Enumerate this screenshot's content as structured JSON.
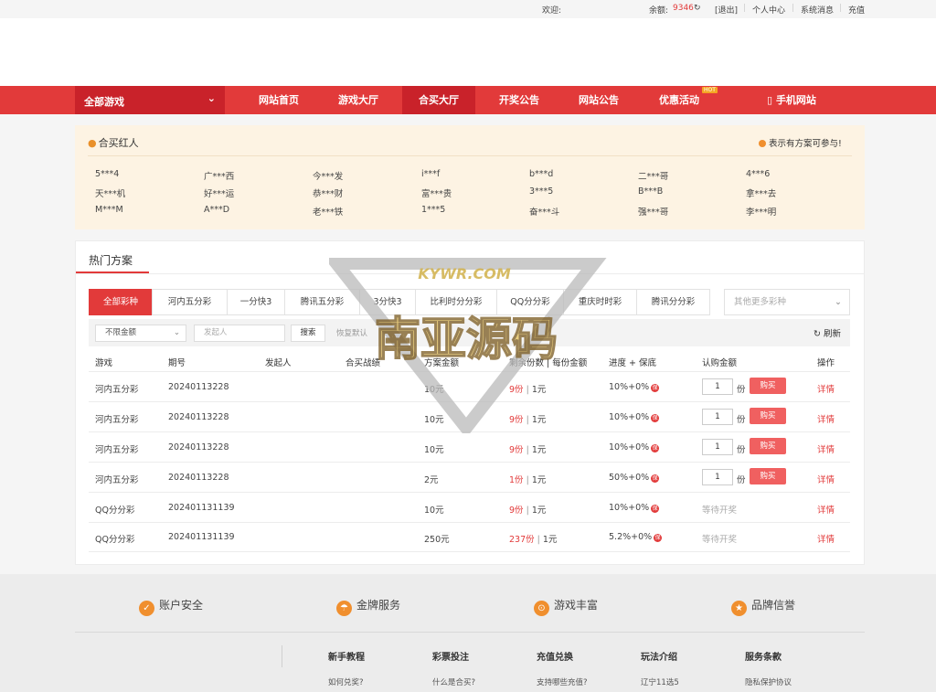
{
  "topbar": {
    "welcome": "欢迎:",
    "balance_label": "余额:",
    "balance_value": "9346",
    "refresh_icon": "↻",
    "logout": "[退出]",
    "user_center": "个人中心",
    "messages": "系统消息",
    "recharge": "充值"
  },
  "nav": {
    "all_games": "全部游戏",
    "items": [
      "网站首页",
      "游戏大厅",
      "合买大厅",
      "开奖公告",
      "网站公告",
      "优惠活动",
      "手机网站"
    ],
    "hot_badge": "HOT",
    "accent": "#e23a3a"
  },
  "hongren": {
    "title": "合买红人",
    "note": "表示有方案可参与!",
    "names": [
      [
        "5***4",
        "广***西",
        "今***发",
        "i***f",
        "b***d",
        "二***哥",
        "4***6"
      ],
      [
        "天***机",
        "好***运",
        "恭***财",
        "富***贵",
        "3***5",
        "B***B",
        "拿***去"
      ],
      [
        "M***M",
        "A***D",
        "老***铁",
        "1***5",
        "奋***斗",
        "强***哥",
        "李***明"
      ]
    ]
  },
  "hot": {
    "title": "热门方案",
    "tabs": [
      "全部彩种",
      "河内五分彩",
      "一分快3",
      "腾讯五分彩",
      "3分快3",
      "比利时分分彩",
      "QQ分分彩",
      "重庆时时彩",
      "腾讯分分彩"
    ],
    "more_select": "其他更多彩种",
    "filter": {
      "amount_select": "不限金额",
      "initiator_placeholder": "发起人",
      "search": "搜索",
      "reset": "恢复默认",
      "refresh": "刷新"
    },
    "headers": [
      "游戏",
      "期号",
      "发起人",
      "合买战绩",
      "方案金额",
      "剩余份数 | 每份金额",
      "进度 + 保底",
      "认购金额",
      "操作"
    ],
    "unit_fen": "份",
    "buy_label": "购买",
    "detail_label": "详情",
    "rows": [
      {
        "game": "河内五分彩",
        "issue": "20240113228",
        "amount": "10元",
        "remain": "9份",
        "per": "1元",
        "progress": "10%+0%",
        "qty": "1",
        "waiting": ""
      },
      {
        "game": "河内五分彩",
        "issue": "20240113228",
        "amount": "10元",
        "remain": "9份",
        "per": "1元",
        "progress": "10%+0%",
        "qty": "1",
        "waiting": ""
      },
      {
        "game": "河内五分彩",
        "issue": "20240113228",
        "amount": "10元",
        "remain": "9份",
        "per": "1元",
        "progress": "10%+0%",
        "qty": "1",
        "waiting": ""
      },
      {
        "game": "河内五分彩",
        "issue": "20240113228",
        "amount": "2元",
        "remain": "1份",
        "per": "1元",
        "progress": "50%+0%",
        "qty": "1",
        "waiting": ""
      },
      {
        "game": "QQ分分彩",
        "issue": "202401131139",
        "amount": "10元",
        "remain": "9份",
        "per": "1元",
        "progress": "10%+0%",
        "qty": "",
        "waiting": "等待开奖"
      },
      {
        "game": "QQ分分彩",
        "issue": "202401131139",
        "amount": "250元",
        "remain": "237份",
        "per": "1元",
        "progress": "5.2%+0%",
        "qty": "",
        "waiting": "等待开奖"
      }
    ]
  },
  "footer": {
    "features": [
      "账户安全",
      "金牌服务",
      "游戏丰富",
      "品牌信誉"
    ],
    "columns": [
      {
        "title": "新手教程",
        "link": "如何兑奖?"
      },
      {
        "title": "彩票投注",
        "link": "什么是合买?"
      },
      {
        "title": "充值兑换",
        "link": "支持哪些充值?"
      },
      {
        "title": "玩法介绍",
        "link": "辽宁11选5"
      },
      {
        "title": "服务条款",
        "link": "隐私保护协议"
      }
    ]
  },
  "watermark": {
    "top_text": "KYWR.COM",
    "main_text": "南亚源码"
  }
}
